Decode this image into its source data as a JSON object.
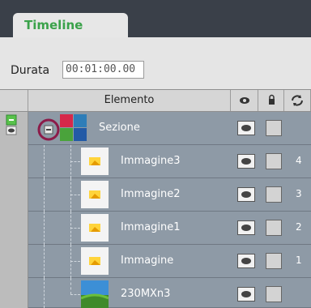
{
  "tab": {
    "label": "Timeline"
  },
  "duration": {
    "label": "Durata",
    "value": "00:01:00.00"
  },
  "columns": {
    "element": "Elemento"
  },
  "rows": [
    {
      "name": "Sezione",
      "num": ""
    },
    {
      "name": "Immagine3",
      "num": "4"
    },
    {
      "name": "Immagine2",
      "num": "3"
    },
    {
      "name": "Immagine1",
      "num": "2"
    },
    {
      "name": "Immagine",
      "num": "1"
    },
    {
      "name": "230MXn3",
      "num": ""
    }
  ],
  "colors": {
    "accent": "#3aa24a",
    "highlight": "#8c1b49",
    "row_bg": "#8e9aa6"
  },
  "icons": [
    "eye-icon",
    "lock-icon",
    "sync-icon",
    "collapse-icon",
    "image-icon"
  ]
}
